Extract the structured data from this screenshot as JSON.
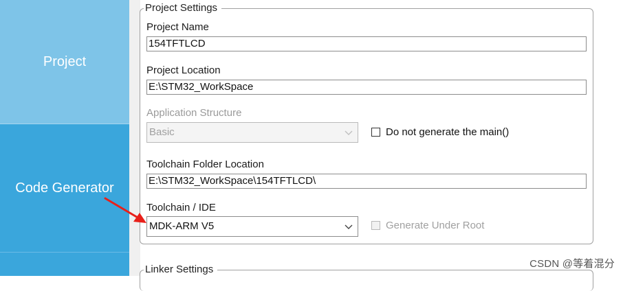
{
  "sidebar": {
    "items": [
      {
        "label": "Project"
      },
      {
        "label": "Code Generator"
      },
      {
        "label": ""
      }
    ]
  },
  "project_settings": {
    "legend": "Project Settings",
    "project_name": {
      "label": "Project Name",
      "value": "154TFTLCD"
    },
    "project_location": {
      "label": "Project Location",
      "value": "E:\\STM32_WorkSpace"
    },
    "application_structure": {
      "label": "Application Structure",
      "value": "Basic"
    },
    "do_not_generate_main": {
      "label": "Do not generate the main()",
      "checked": false
    },
    "toolchain_folder": {
      "label": "Toolchain Folder Location",
      "value": "E:\\STM32_WorkSpace\\154TFTLCD\\"
    },
    "toolchain_ide": {
      "label": "Toolchain / IDE",
      "value": "MDK-ARM V5"
    },
    "generate_under_root": {
      "label": "Generate Under Root",
      "checked": false
    }
  },
  "linker_settings": {
    "legend": "Linker Settings"
  },
  "colors": {
    "sidebar_active": "#3aa6dc",
    "sidebar_inactive": "#7ec4e8",
    "annotation_arrow": "#e8201a"
  },
  "watermark": "CSDN @等着混分"
}
